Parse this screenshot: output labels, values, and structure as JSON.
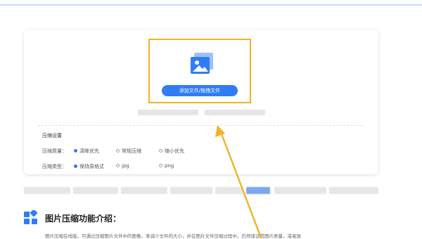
{
  "upload": {
    "button_label": "添加文件/拖拽文件",
    "icon": "image-icon"
  },
  "settings": {
    "title": "压缩设置",
    "mode": {
      "label": "压缩质量：",
      "options": [
        "清晰优先",
        "常规压缩",
        "缩小优先"
      ],
      "selected": "清晰优先"
    },
    "format": {
      "label": "压缩类型：",
      "options": [
        "保持原格式",
        "jpg",
        "png"
      ],
      "selected": "保持原格式"
    }
  },
  "intro": {
    "title": "图片压缩功能介绍：",
    "text": "图片压缩在线版，可通过压缩图片文件中的图像，来减少文件的大小，并在图片文件压缩过程中，仍然保证其图片质量，或者放",
    "icon": "grid-icon"
  },
  "colors": {
    "accent": "#2f7cf6",
    "highlight": "#f2b321"
  }
}
